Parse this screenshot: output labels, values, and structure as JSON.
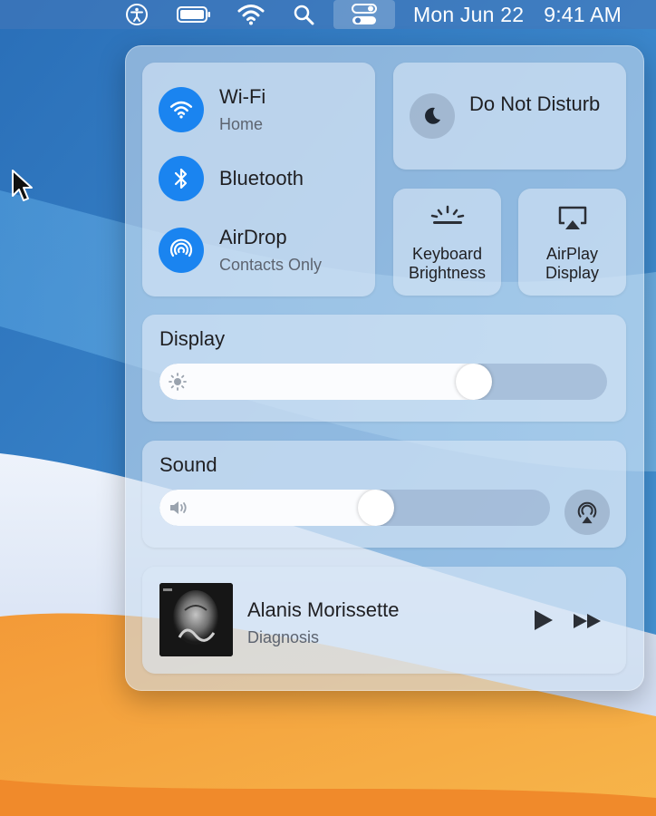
{
  "menubar": {
    "icons": [
      "accessibility-icon",
      "battery-icon",
      "wifi-icon",
      "search-icon",
      "control-center-icon"
    ],
    "date": "Mon Jun 22",
    "time": "9:41 AM"
  },
  "control_center": {
    "network": [
      {
        "title": "Wi-Fi",
        "subtitle": "Home",
        "icon": "wifi-icon",
        "active": true
      },
      {
        "title": "Bluetooth",
        "subtitle": "",
        "icon": "bluetooth-icon",
        "active": true
      },
      {
        "title": "AirDrop",
        "subtitle": "Contacts Only",
        "icon": "airdrop-icon",
        "active": true
      }
    ],
    "do_not_disturb": {
      "label": "Do Not Disturb",
      "icon": "moon-icon"
    },
    "keyboard_brightness": {
      "line1": "Keyboard",
      "line2": "Brightness",
      "icon": "keyboard-brightness-icon"
    },
    "airplay_display": {
      "line1": "AirPlay",
      "line2": "Display",
      "icon": "airplay-display-icon"
    },
    "display": {
      "title": "Display",
      "level": 0.72,
      "icon": "sun-icon"
    },
    "sound": {
      "title": "Sound",
      "level": 0.56,
      "icon": "speaker-icon",
      "output_icon": "airplay-audio-icon"
    },
    "now_playing": {
      "title": "Alanis Morissette",
      "subtitle": "Diagnosis"
    }
  },
  "colors": {
    "accent": "#1a84f0",
    "wallpaper_blue": "#2a79c2",
    "wallpaper_orange": "#f6a23a"
  }
}
